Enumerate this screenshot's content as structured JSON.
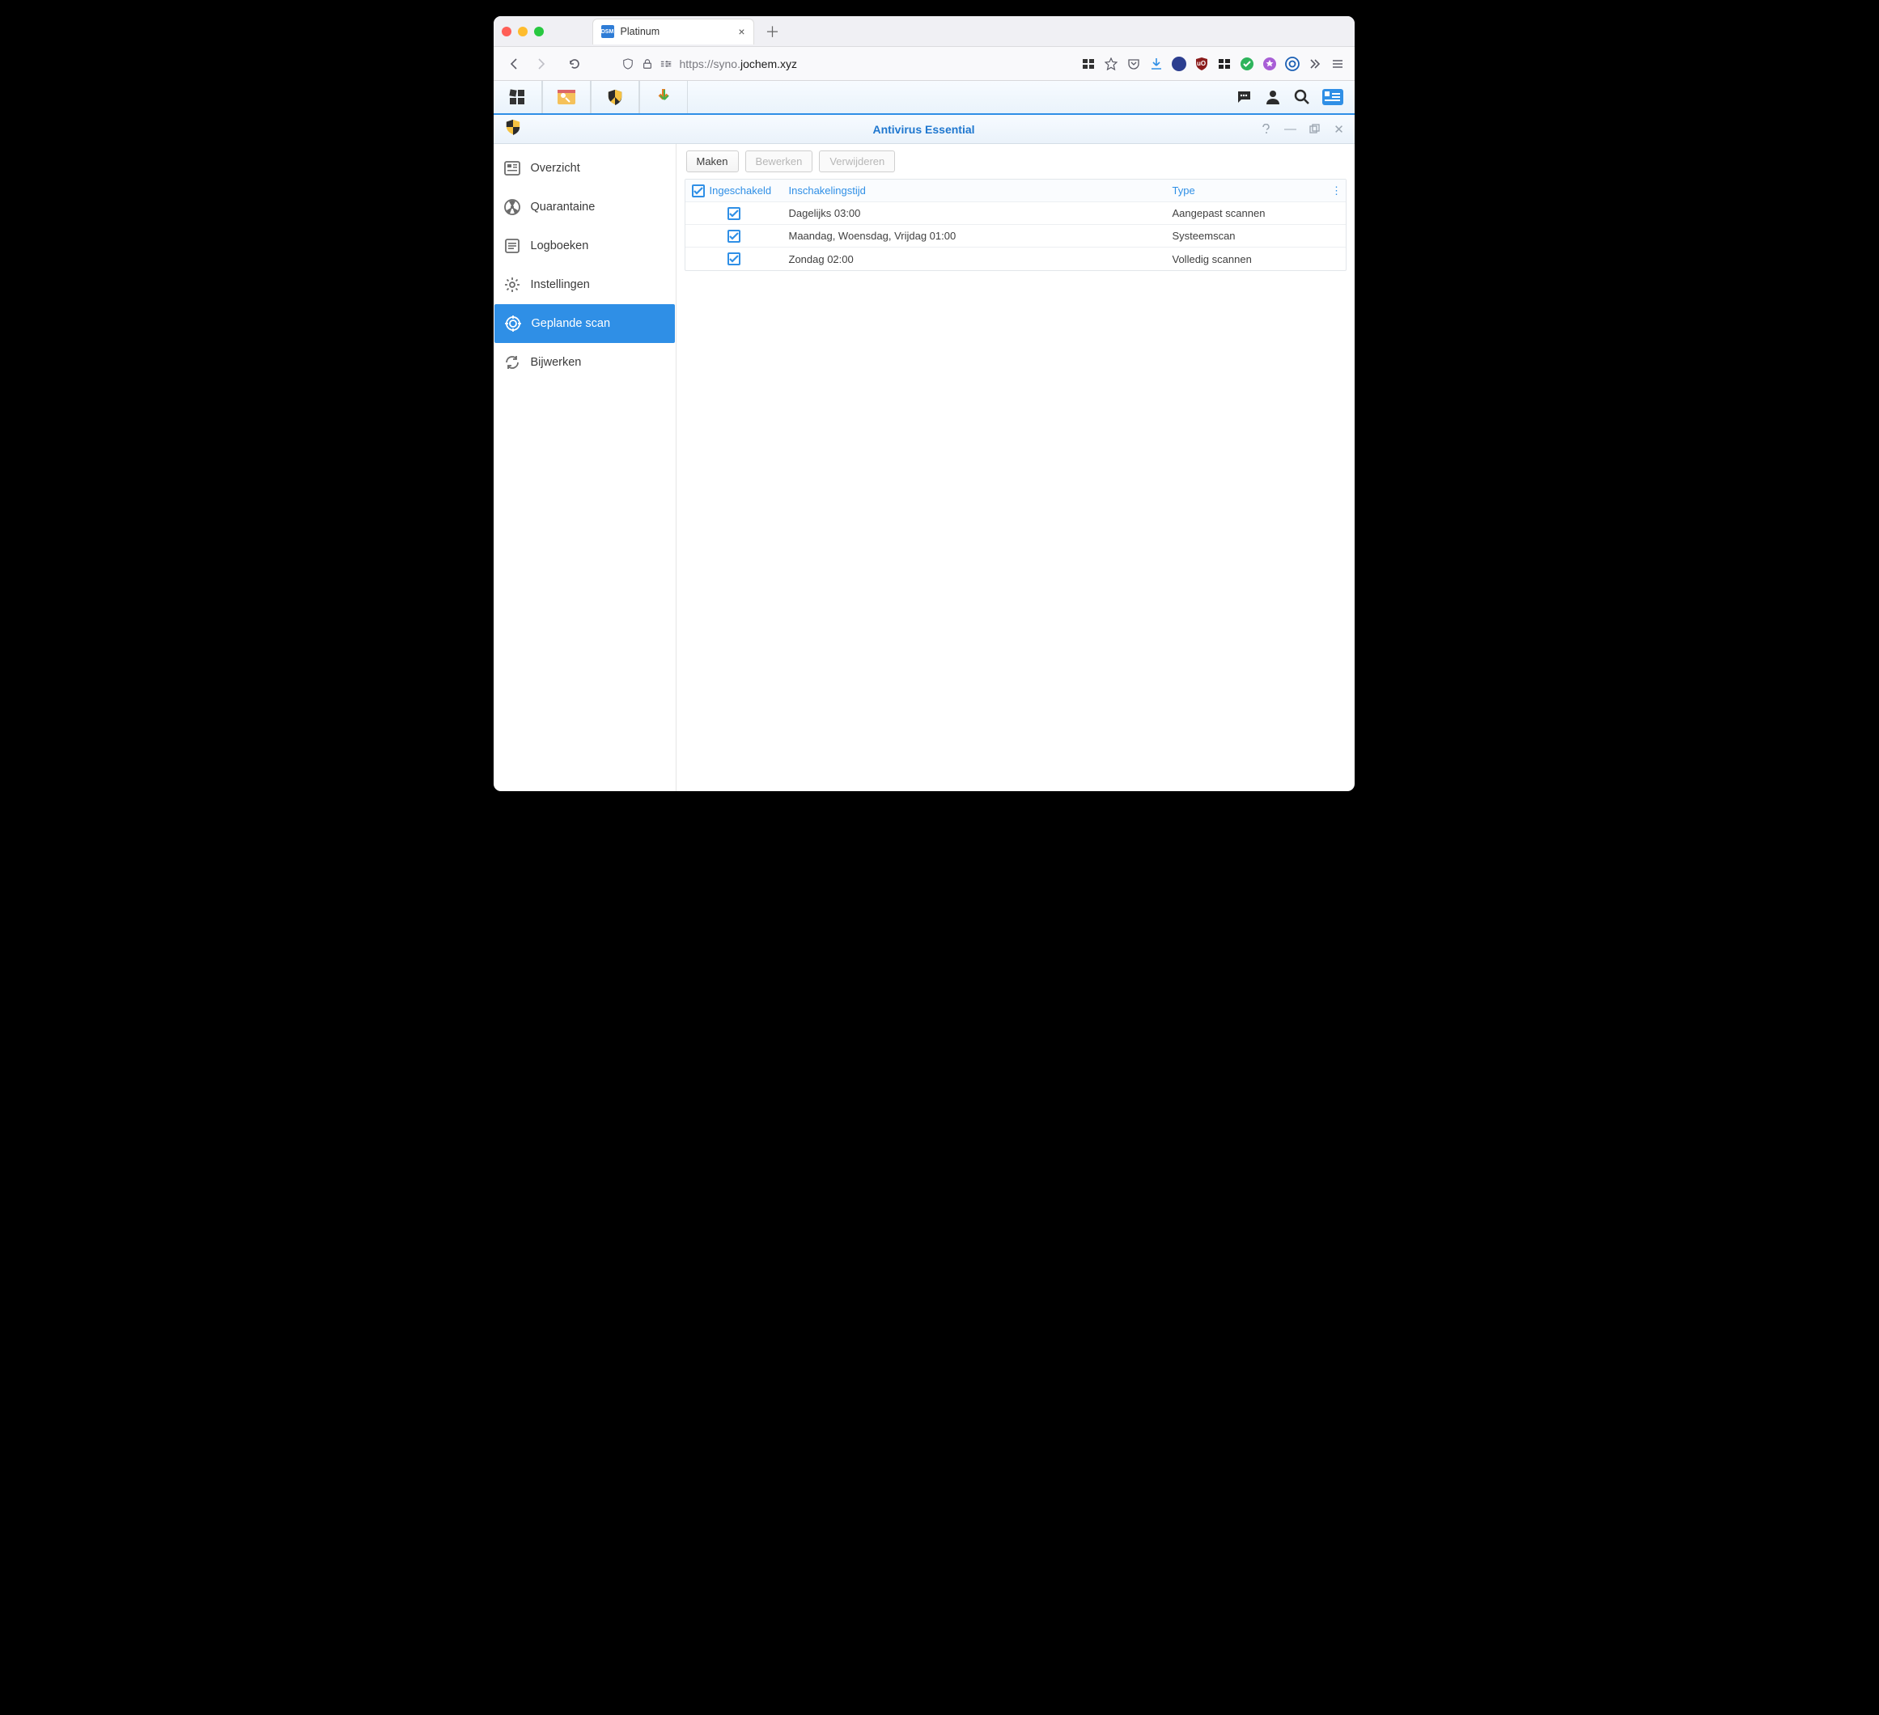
{
  "browser": {
    "tab_title": "Platinum",
    "url_prefix": "https://syno.",
    "url_host": "jochem.xyz"
  },
  "app": {
    "title": "Antivirus Essential",
    "sidebar": {
      "items": [
        {
          "label": "Overzicht"
        },
        {
          "label": "Quarantaine"
        },
        {
          "label": "Logboeken"
        },
        {
          "label": "Instellingen"
        },
        {
          "label": "Geplande scan"
        },
        {
          "label": "Bijwerken"
        }
      ]
    },
    "buttons": {
      "create": "Maken",
      "edit": "Bewerken",
      "delete": "Verwijderen"
    },
    "table": {
      "headers": {
        "enabled": "Ingeschakeld",
        "time": "Inschakelingstijd",
        "type": "Type"
      },
      "rows": [
        {
          "time": "Dagelijks 03:00",
          "type": "Aangepast scannen"
        },
        {
          "time": "Maandag, Woensdag, Vrijdag 01:00",
          "type": "Systeemscan"
        },
        {
          "time": "Zondag 02:00",
          "type": "Volledig scannen"
        }
      ]
    }
  }
}
